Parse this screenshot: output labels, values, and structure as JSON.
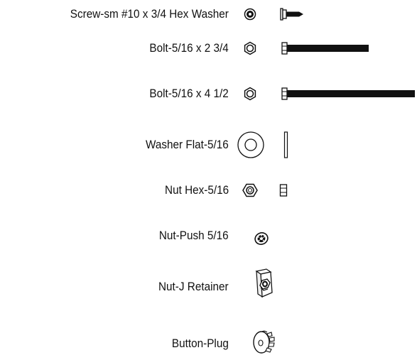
{
  "parts": [
    {
      "label": "Screw-sm #10 x 3/4 Hex Washer",
      "icons": [
        "hex-washer-head-icon",
        "screw-side-view-icon"
      ]
    },
    {
      "label": "Bolt-5/16 x 2 3/4",
      "icons": [
        "hex-head-icon",
        "bolt-side-view-icon"
      ]
    },
    {
      "label": "Bolt-5/16 x 4 1/2",
      "icons": [
        "hex-head-icon",
        "long-bolt-side-view-icon"
      ]
    },
    {
      "label": "Washer Flat-5/16",
      "icons": [
        "flat-washer-icon",
        "washer-side-view-icon"
      ]
    },
    {
      "label": "Nut Hex-5/16",
      "icons": [
        "hex-nut-icon",
        "nut-side-view-icon"
      ]
    },
    {
      "label": "Nut-Push 5/16",
      "icons": [
        "push-nut-icon"
      ]
    },
    {
      "label": "Nut-J Retainer",
      "icons": [
        "j-retainer-nut-icon"
      ]
    },
    {
      "label": "Button-Plug",
      "icons": [
        "button-plug-icon"
      ]
    }
  ],
  "colors": {
    "ink": "#111111",
    "background": "#ffffff"
  }
}
